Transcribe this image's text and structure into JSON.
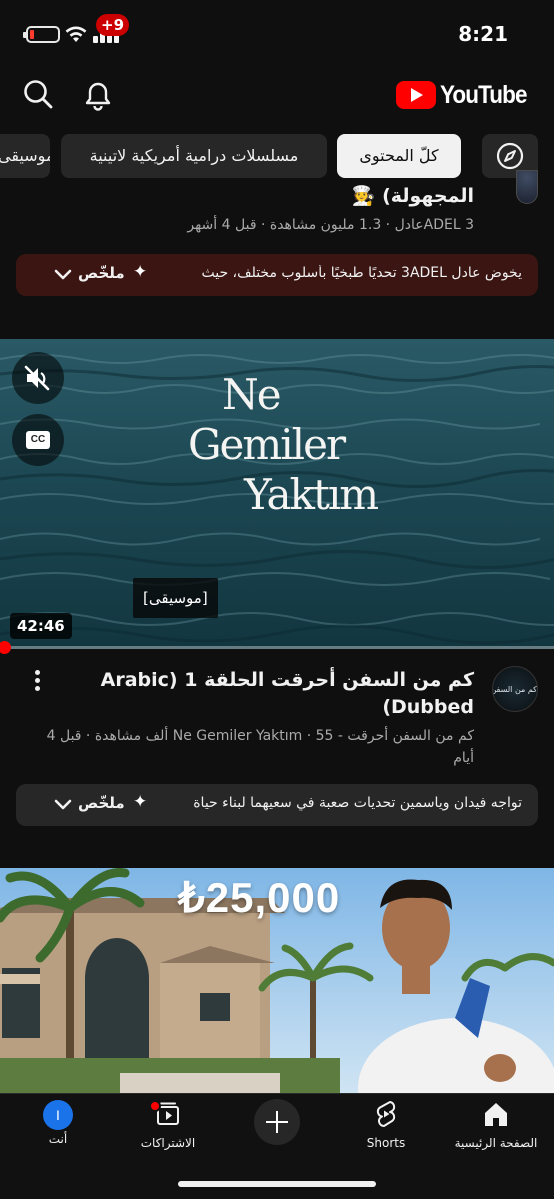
{
  "status_bar": {
    "time": "8:21"
  },
  "header": {
    "logo_text": "YouTube",
    "notification_count": "+9"
  },
  "chips": [
    {
      "label": "",
      "icon": "compass-icon"
    },
    {
      "label": "كلّ المحتوى",
      "active": true
    },
    {
      "label": "مسلسلات درامية أمريكية لاتينية"
    },
    {
      "label": "موسيقى"
    }
  ],
  "video_1": {
    "title": "المجهولة) 🧑‍🍳",
    "meta": "ADEL 3عادل · 1.3 مليون مشاهدة · قبل 4 أشهر",
    "summary_text": "يخوض عادل 3ADEL تحديًا طبخيًا بأسلوب مختلف، حيث",
    "summary_label": "ملخّص"
  },
  "video_2": {
    "title_art_lines": [
      "Ne",
      "Gemiler",
      "Yaktım"
    ],
    "caption": "[موسيقى]",
    "duration": "42:46",
    "progress": 0.01,
    "channel_avatar_text": "كم من السفن أحرقت",
    "title": "كم من السفن أحرقت الحلقة 1 Arabic) (Dubbed",
    "meta": "كم من السفن أحرقت - Ne Gemiler Yaktım · 55 ألف مشاهدة · قبل 4 أيام",
    "summary_text": "تواجه فيدان وياسمين تحديات صعبة في سعيهما لبناء حياة",
    "summary_label": "ملخّص"
  },
  "video_3": {
    "price_text": "₺25,000"
  },
  "bottom_nav": {
    "home": "الصفحة الرئيسية",
    "shorts": "Shorts",
    "subscriptions": "الاشتراكات",
    "you": "أنت",
    "you_avatar_letter": "I"
  },
  "colors": {
    "brand_red": "#ff0000",
    "background": "#0f0f0f",
    "chip_bg": "#272727",
    "summary_warm": "#3a1512"
  }
}
